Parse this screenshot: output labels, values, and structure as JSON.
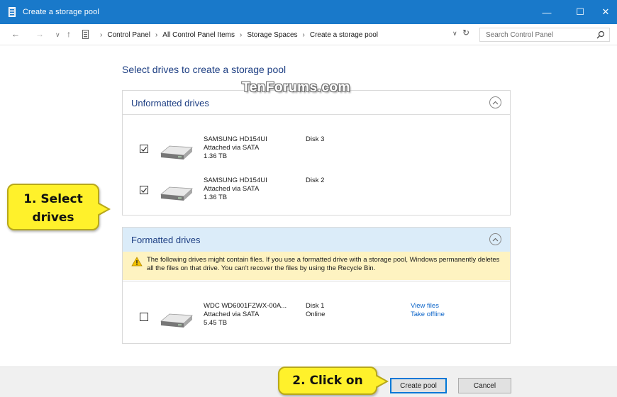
{
  "window": {
    "title": "Create a storage pool",
    "controls": {
      "minimize": "—",
      "maximize": "☐",
      "close": "✕"
    }
  },
  "addressbar": {
    "back": "←",
    "forward": "→",
    "recent": "∨",
    "up": "↑",
    "breadcrumbs": [
      "Control Panel",
      "All Control Panel Items",
      "Storage Spaces",
      "Create a storage pool"
    ],
    "separator": "›",
    "dropdown": "∨",
    "refresh": "↻",
    "search_placeholder": "Search Control Panel"
  },
  "main": {
    "page_title": "Select drives to create a storage pool",
    "watermark": "TenForums.com",
    "unformatted": {
      "header": "Unformatted drives",
      "drives": [
        {
          "name": "SAMSUNG HD154UI",
          "connection": "Attached via SATA",
          "size": "1.36 TB",
          "disk": "Disk 3",
          "checked": true
        },
        {
          "name": "SAMSUNG HD154UI",
          "connection": "Attached via SATA",
          "size": "1.36 TB",
          "disk": "Disk 2",
          "checked": true
        }
      ]
    },
    "formatted": {
      "header": "Formatted drives",
      "warning": "The following drives might contain files. If you use a formatted drive with a storage pool, Windows permanently deletes all the files on that drive. You can't recover the files by using the Recycle Bin.",
      "drives": [
        {
          "name": "WDC WD6001FZWX-00A...",
          "connection": "Attached via SATA",
          "size": "5.45 TB",
          "disk": "Disk 1",
          "status": "Online",
          "checked": false,
          "link1": "View files",
          "link2": "Take offline"
        }
      ]
    }
  },
  "footer": {
    "create_label": "Create pool",
    "cancel_label": "Cancel"
  },
  "callouts": {
    "select_line1": "1. Select",
    "select_line2": "drives",
    "click": "2. Click on"
  },
  "colors": {
    "titlebar": "#1979ca",
    "heading": "#1e3f83",
    "link": "#0d65c8",
    "warning_bg": "#fef3c1",
    "formatted_header_bg": "#dbecf9",
    "callout": "#fff12b"
  }
}
